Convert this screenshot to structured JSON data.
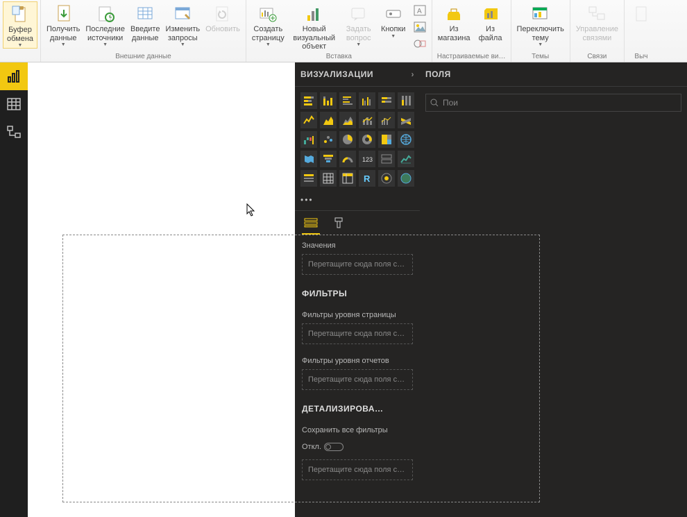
{
  "ribbon": {
    "groups": {
      "externalData": {
        "label": "Внешние данные",
        "clipboard": "Буфер\nобмена",
        "getData": "Получить\nданные",
        "recentSources": "Последние\nисточники",
        "enterData": "Введите\nданные",
        "editQueries": "Изменить\nзапросы",
        "refresh": "Обновить"
      },
      "insert": {
        "label": "Вставка",
        "newPage": "Создать\nстраницу",
        "newVisual": "Новый визуальный\nобъект",
        "askQuestion": "Задать\nвопрос",
        "buttons": "Кнопки"
      },
      "custom": {
        "label": "Настраиваемые ви…",
        "fromStore": "Из\nмагазина",
        "fromFile": "Из\nфайла"
      },
      "themes": {
        "label": "Темы",
        "switchTheme": "Переключить\nтему"
      },
      "relations": {
        "label": "Связи",
        "manage": "Управление\nсвязями"
      },
      "calc": {
        "label": "Выч"
      }
    }
  },
  "viz": {
    "title": "ВИЗУАЛИЗАЦИИ",
    "valuesLabel": "Значения",
    "drop": "Перетащите сюда поля с д…",
    "filtersTitle": "ФИЛЬТРЫ",
    "pageFilters": "Фильтры уровня страницы",
    "reportFilters": "Фильтры уровня отчетов",
    "drop2": "Перетащите сюда поля с …",
    "drillTitle": "ДЕТАЛИЗИРОВА…",
    "keepFilters": "Сохранить все фильтры",
    "off": "Откл."
  },
  "fields": {
    "title": "ПОЛЯ",
    "search": "Пои"
  }
}
